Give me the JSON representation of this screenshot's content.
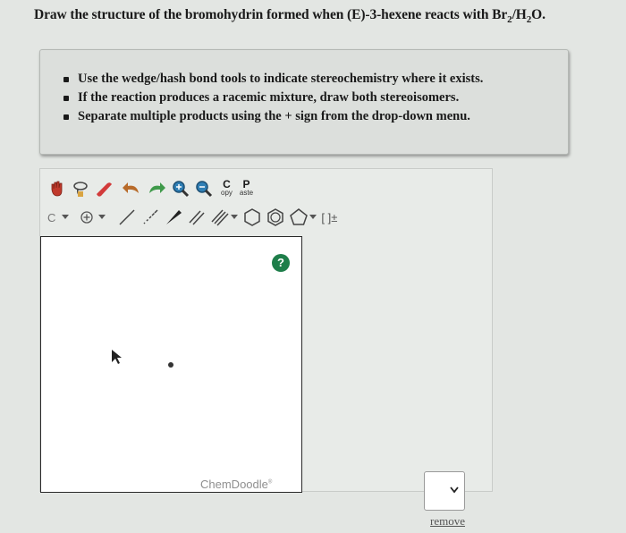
{
  "question": {
    "prefix": "Draw the structure of the bromohydrin formed when ",
    "compound": "(E)-3-hexene",
    "middle": " reacts with Br",
    "sub1": "2",
    "slash": "/H",
    "sub2": "2",
    "suffix": "O."
  },
  "instructions": [
    "Use the wedge/hash bond tools to indicate stereochemistry where it exists.",
    "If the reaction produces a racemic mixture, draw both stereoisomers.",
    "Separate multiple products using the + sign from the drop-down menu."
  ],
  "toolbar": {
    "copy_big": "C",
    "copy_small": "opy",
    "paste_big": "P",
    "paste_small": "aste",
    "element_label": "C",
    "bracket_label": "[ ]±"
  },
  "canvas": {
    "help_label": "?",
    "watermark": "ChemDoodle",
    "watermark_mark": "®"
  },
  "product_select": {
    "value": ""
  },
  "remove_label": "remove",
  "colors": {
    "hand": "#c0392b",
    "eraser": "#d23b3b",
    "lasso": "#b86b2a",
    "help": "#1e7e4a"
  }
}
